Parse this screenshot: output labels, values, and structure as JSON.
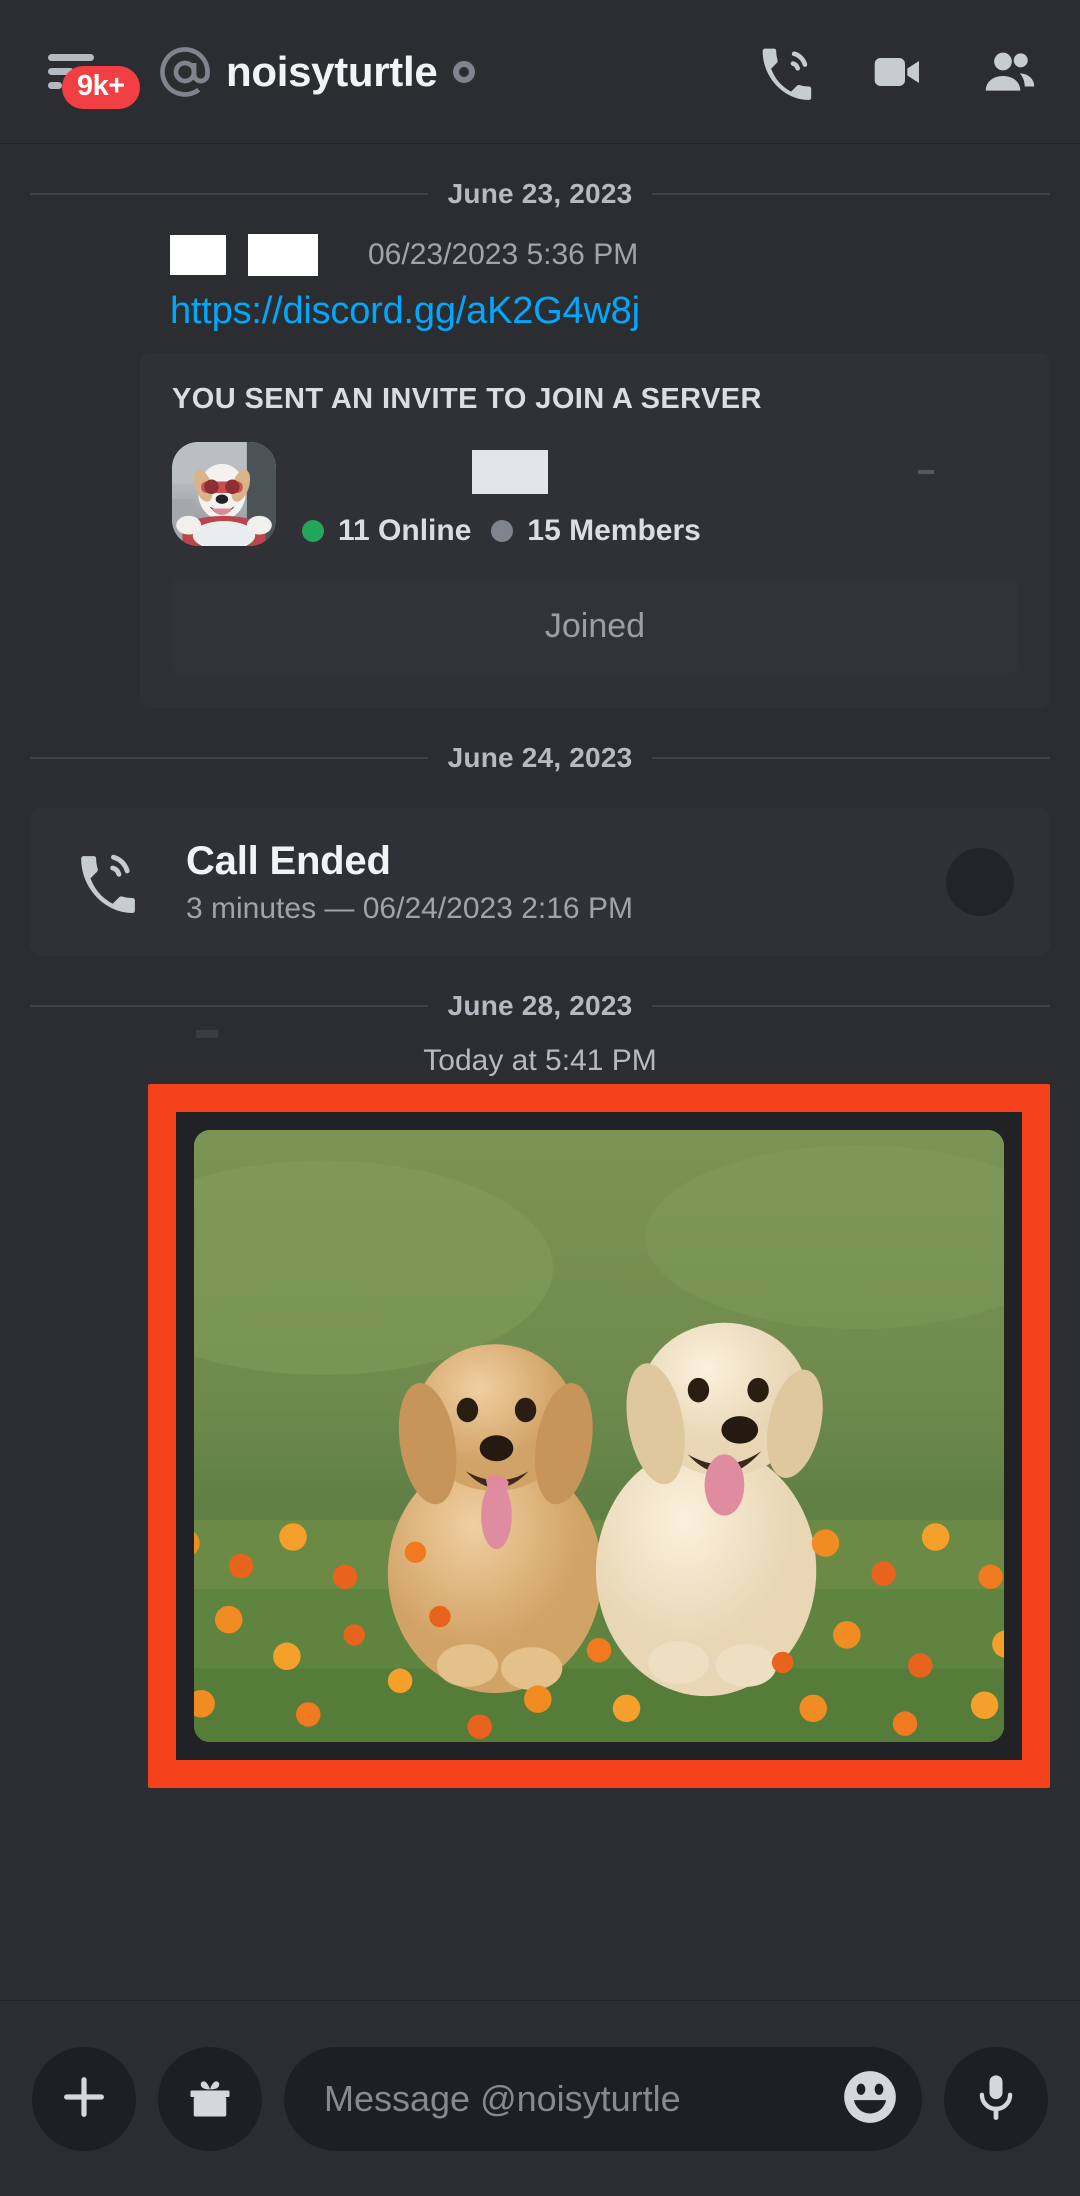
{
  "header": {
    "unread_badge": "9k+",
    "menu_icon": "hamburger-menu-icon",
    "at_icon": "at-sign-icon",
    "dm_username": "noisyturtle",
    "status_icon": "offline-status-icon",
    "actions": [
      {
        "name": "voice-call-icon",
        "label": "Start Voice Call"
      },
      {
        "name": "video-call-icon",
        "label": "Start Video Call"
      },
      {
        "name": "members-icon",
        "label": "Members"
      }
    ]
  },
  "messages": {
    "divider_1": "June 23, 2023",
    "invite_message": {
      "timestamp": "06/23/2023 5:36 PM",
      "link": "https://discord.gg/aK2G4w8j",
      "author_redacted": true
    },
    "invite_card": {
      "title": "YOU SENT AN INVITE TO JOIN A SERVER",
      "server_avatar": "dog-in-sunglasses-avatar",
      "server_name_redacted": true,
      "online_count": "11 Online",
      "members_count": "15 Members",
      "online_color": "#23a55a",
      "members_color": "#80848e",
      "join_button": "Joined"
    },
    "divider_2": "June 24, 2023",
    "call_ended": {
      "icon": "phone-call-icon",
      "title": "Call Ended",
      "subtitle": "3 minutes — 06/24/2023 2:16 PM",
      "action_icon": "call-back-button"
    },
    "divider_3": "June 28, 2023",
    "image_message": {
      "timestamp": "Today at 5:41 PM",
      "attachment": "two-golden-retriever-puppies-photo",
      "highlight_color": "#f5401c"
    }
  },
  "composer": {
    "add_button": "plus-icon",
    "gift_button": "gift-icon",
    "placeholder": "Message @noisyturtle",
    "value": "",
    "emoji_button": "emoji-icon",
    "mic_button": "microphone-icon"
  }
}
